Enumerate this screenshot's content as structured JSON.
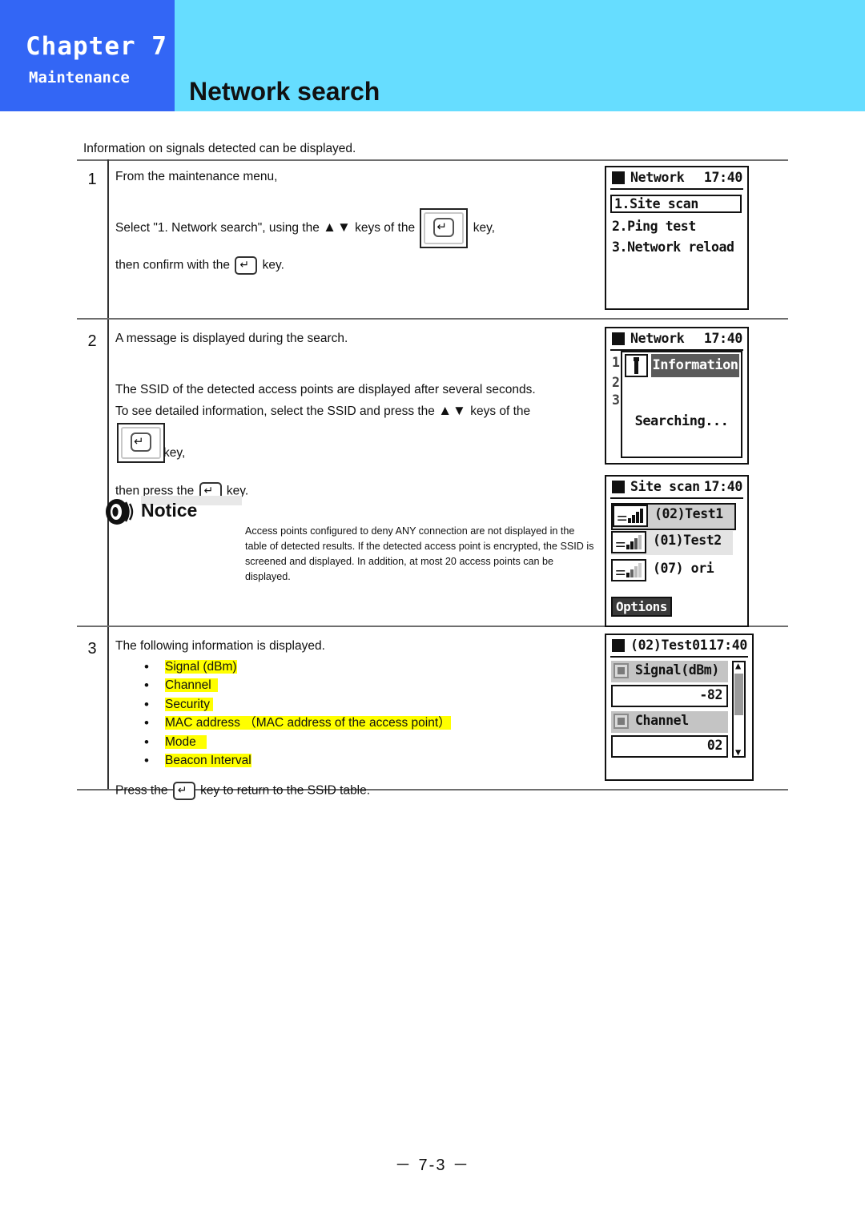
{
  "header": {
    "chapter_label": "Chapter 7",
    "chapter_sub": "Maintenance",
    "page_title": "Network search",
    "blue": "#3366F5",
    "cyan": "#66DDFF"
  },
  "intro": "Information on signals detected can be displayed.",
  "steps": [
    {
      "number": "1",
      "line1": "From the maintenance menu,",
      "line2a": "Select \"1. Network search\", using the",
      "line2b": "keys of the",
      "line2c": "key,",
      "line3a": "then confirm with the",
      "line3b": "key."
    },
    {
      "number": "2",
      "line1": "A message is displayed during the search.",
      "line2": "The SSID of the detected access points are displayed after several seconds.",
      "line3a": "To see detailed information, select the SSID and press the",
      "line3b": "keys of the",
      "line4": "key,",
      "line5a": "then press the",
      "line5b": "key."
    },
    {
      "number": "3",
      "line1": "The following information is displayed.",
      "bullets": [
        "Signal (dBm)",
        "Channel",
        "Security",
        "MAC address  （MAC address of the access point）",
        "Mode",
        "Beacon Interval"
      ],
      "footer_a": "Press the",
      "footer_b": "key to return to the SSID table."
    }
  ],
  "notice": {
    "label": "Notice",
    "body": "Access points configured to deny ANY connection are not displayed in the table of detected results. If the detected access point is encrypted, the SSID is screened and displayed. In addition, at most 20 access points can be displayed."
  },
  "screens": {
    "network_menu": {
      "title": "Network",
      "time": "17:40",
      "items": [
        "1.Site scan",
        "2.Ping test",
        "3.Network reload"
      ],
      "selected_index": 0
    },
    "searching": {
      "title": "Network",
      "time": "17:40",
      "popup_title": "Information",
      "message": "Searching...",
      "behind_items": [
        "1",
        "2",
        "3"
      ]
    },
    "site_scan": {
      "title": "Site scan",
      "time": "17:40",
      "entries": [
        {
          "label": "(02)Test1",
          "bars": 4,
          "state": "selected"
        },
        {
          "label": "(01)Test2",
          "bars": 3,
          "state": "soft"
        },
        {
          "label": "(07) ori",
          "bars": 2,
          "state": "normal"
        }
      ],
      "options_label": "Options"
    },
    "detail": {
      "title": "(02)Test01",
      "time": "17:40",
      "fields": [
        {
          "label": "Signal(dBm)",
          "value": "-82"
        },
        {
          "label": "Channel",
          "value": "02"
        }
      ]
    }
  },
  "footer": "－ 7-3 －"
}
